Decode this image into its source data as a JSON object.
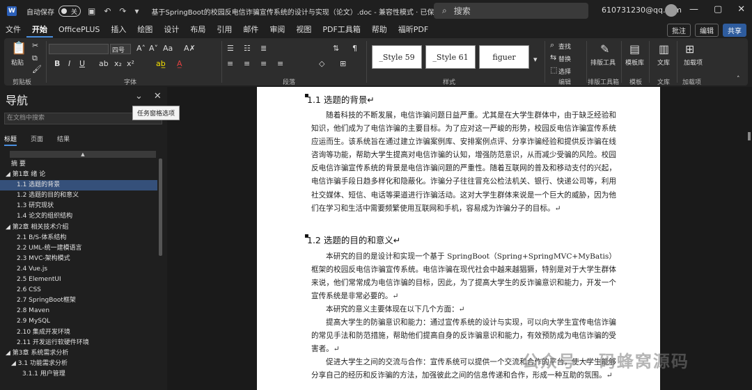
{
  "titlebar": {
    "app_icon": "W",
    "autosave_label": "自动保存",
    "autosave_state": "关",
    "title": "基于SpringBoot的校园反电信诈骗宣传系统的设计与实现（论文）.doc - 兼容性模式 · 已保存",
    "search_placeholder": "搜索",
    "user_email": "610731230@qq.com"
  },
  "menu": {
    "tabs": [
      "文件",
      "开始",
      "OfficePLUS",
      "插入",
      "绘图",
      "设计",
      "布局",
      "引用",
      "邮件",
      "审阅",
      "视图",
      "PDF工具箱",
      "帮助",
      "福昕PDF"
    ],
    "active": "开始",
    "comment_btn": "批注",
    "edit_btn": "编辑",
    "share_btn": "共享"
  },
  "ribbon": {
    "paste": "粘贴",
    "clipboard": "剪贴板",
    "font_size": "四号",
    "font_group": "字体",
    "paragraph_group": "段落",
    "styles": [
      "_Style 59",
      "_Style 61",
      "figuer"
    ],
    "styles_group": "样式",
    "find": "查找",
    "replace": "替换",
    "select": "选择",
    "edit_group": "编辑",
    "layout_tool": "排版工具",
    "layout_group": "排版工具箱",
    "template": "模板库",
    "template_group": "模板",
    "library": "文库",
    "library_group": "文库",
    "addins": "加载项",
    "addins_label": "加载项"
  },
  "nav": {
    "title": "导航",
    "tooltip": "任务窗格选项",
    "search_placeholder": "在文档中搜索",
    "tabs": [
      "标题",
      "页面",
      "结果"
    ],
    "items": [
      {
        "text": "摘 要",
        "indent": 2
      },
      {
        "text": "◢ 第1章  绪 论",
        "indent": 1
      },
      {
        "text": "1.1  选题的背景",
        "indent": 3
      },
      {
        "text": "1.2  选题的目的和意义",
        "indent": 3
      },
      {
        "text": "1.3  研究现状",
        "indent": 3
      },
      {
        "text": "1.4  论文的组织结构",
        "indent": 3
      },
      {
        "text": "◢ 第2章  相关技术介绍",
        "indent": 1
      },
      {
        "text": "2.1  B/S-体系结构",
        "indent": 3
      },
      {
        "text": "2.2  UML-统一建模语言",
        "indent": 3
      },
      {
        "text": "2.3  MVC-架构模式",
        "indent": 3
      },
      {
        "text": "2.4  Vue.js",
        "indent": 3
      },
      {
        "text": "2.5  ElementUI",
        "indent": 3
      },
      {
        "text": "2.6  CSS",
        "indent": 3
      },
      {
        "text": "2.7  SpringBoot框架",
        "indent": 3
      },
      {
        "text": "2.8  Maven",
        "indent": 3
      },
      {
        "text": "2.9  MySQL",
        "indent": 3
      },
      {
        "text": "2.10  集成开发环境",
        "indent": 3
      },
      {
        "text": "2.11  开发运行软硬件环境",
        "indent": 3
      },
      {
        "text": "◢ 第3章  系统需求分析",
        "indent": 1
      },
      {
        "text": "◢ 3.1  功能需求分析",
        "indent": 2
      },
      {
        "text": "3.1.1  用户管理",
        "indent": 4
      }
    ],
    "selected_index": 2
  },
  "document": {
    "heading1": "1.1   选题的背景↵",
    "para1": "随着科技的不断发展，电信诈骗问题日益严重。尤其是在大学生群体中，由于缺乏经验和知识，他们成为了电信诈骗的主要目标。为了应对这一严峻的形势，校园反电信诈骗宣传系统应运而生。该系统旨在通过建立诈骗案例库、安排案例点评、分享诈骗经验和提供反诈骗在线咨询等功能，帮助大学生提高对电信诈骗的认知，增强防范意识，从而减少受骗的风险。校园反电信诈骗宣传系统的背景是电信诈骗问题的严重性。随着互联网的普及和移动支付的兴起，电信诈骗手段日趋多样化和隐蔽化。诈骗分子往往冒充公检法机关、银行、快递公司等，利用社交媒体、短信、电话等渠道进行诈骗活动。这对大学生群体来说是一个巨大的威胁，因为他们在学习和生活中需要频繁使用互联网和手机，容易成为诈骗分子的目标。↵",
    "heading2": "1.2   选题的目的和意义↵",
    "para2": "本研究的目的是设计和实现一个基于 SpringBoot（Spring+SpringMVC+MyBatis）框架的校园反电信诈骗宣传系统。电信诈骗在现代社会中越来越猖獗，特别是对于大学生群体来说，他们常常成为电信诈骗的目标，因此，为了提高大学生的反诈骗意识和能力，开发一个宣传系统是非常必要的。↵",
    "para3": "本研究的意义主要体现在以下几个方面：↵",
    "para4": "提高大学生的防骗意识和能力：通过宣传系统的设计与实现，可以向大学生宣传电信诈骗的常见手法和防范措施，帮助他们提高自身的反诈骗意识和能力，有效预防成为电信诈骗的受害者。↵",
    "para5": "促进大学生之间的交流与合作：宣传系统可以提供一个交流和合作的平台，使大学生能够分享自己的经历和反诈骗的方法，加强彼此之间的信息传递和合作，形成一种互助的氛围。↵"
  },
  "watermark": "公众号 · 码蜂窝源码",
  "colors": {
    "accent": "#4a8fe0",
    "selected": "#35507a",
    "page": "#ffffff"
  }
}
